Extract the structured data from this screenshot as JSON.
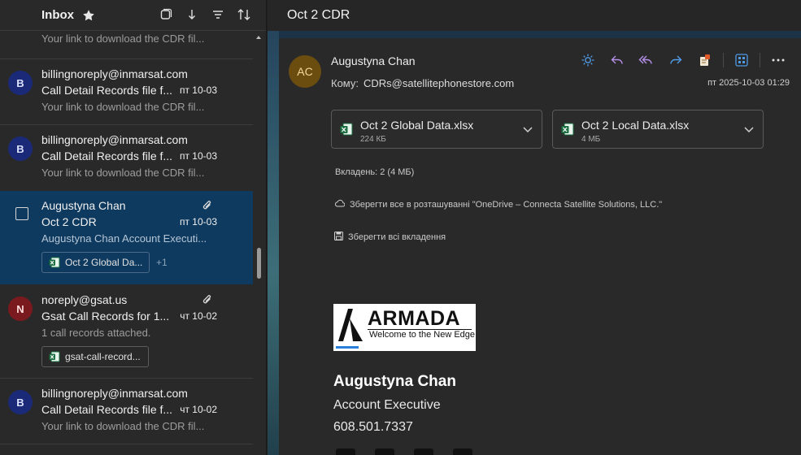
{
  "list": {
    "title": "Inbox",
    "first_snippet": "Your link to download the CDR fil...",
    "mails": [
      {
        "avatar": "B",
        "sender": "billingnoreply@inmarsat.com",
        "subject": "Call Detail Records file f...",
        "date": "пт 10-03",
        "snippet": "Your link to download the CDR fil..."
      },
      {
        "avatar": "B",
        "sender": "billingnoreply@inmarsat.com",
        "subject": "Call Detail Records file f...",
        "date": "пт 10-03",
        "snippet": "Your link to download the CDR fil..."
      },
      {
        "sender": "Augustyna Chan",
        "subject": "Oct 2 CDR",
        "date": "пт 10-03",
        "snippet": "Augustyna Chan Account Executi...",
        "attachment": "Oct 2 Global Da...",
        "more": "+1"
      },
      {
        "avatar": "N",
        "sender": "noreply@gsat.us",
        "subject": "Gsat Call Records for 1...",
        "date": "чт 10-02",
        "snippet": "1 call records attached.",
        "attachment": "gsat-call-record..."
      },
      {
        "avatar": "B",
        "sender": "billingnoreply@inmarsat.com",
        "subject": "Call Detail Records file f...",
        "date": "чт 10-02",
        "snippet": "Your link to download the CDR fil..."
      }
    ]
  },
  "reading": {
    "subject": "Oct 2 CDR",
    "avatar_initials": "AC",
    "from": "Augustyna Chan",
    "to_label": "Кому:",
    "to": "CDRs@satellitephonestore.com",
    "date": "пт 2025-10-03 01:29",
    "attachments": [
      {
        "name": "Oct 2 Global Data.xlsx",
        "size": "224 КБ"
      },
      {
        "name": "Oct 2 Local Data.xlsx",
        "size": "4 МБ"
      }
    ],
    "attachment_count": "Вкладень: 2 (4 МБ)",
    "save_onedrive": "Зберегти все в розташуванні \"OneDrive – Connecta Satellite Solutions, LLC.\"",
    "save_all": "Зберегти всі вкладення",
    "logo": {
      "word": "ARMADA",
      "tagline": "Welcome to the New Edge"
    },
    "signature": {
      "name": "Augustyna Chan",
      "title": "Account Executive",
      "phone": "608.501.7337"
    }
  },
  "colors": {
    "selected_row": "#0f3a5f",
    "accent": "#4f9be6",
    "reply_purple": "#b48fe8"
  }
}
